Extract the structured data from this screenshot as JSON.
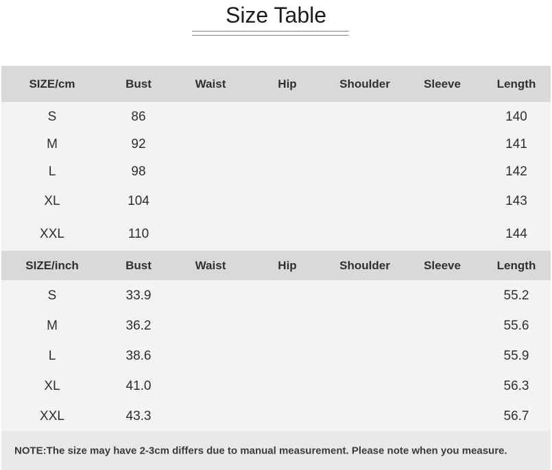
{
  "title": "Size Table",
  "tables": [
    {
      "headers": [
        "SIZE/cm",
        "Bust",
        "Waist",
        "Hip",
        "Shoulder",
        "Sleeve",
        "Length"
      ],
      "rows": [
        [
          "S",
          "86",
          "",
          "",
          "",
          "",
          "140"
        ],
        [
          "M",
          "92",
          "",
          "",
          "",
          "",
          "141"
        ],
        [
          "L",
          "98",
          "",
          "",
          "",
          "",
          "142"
        ],
        [
          "XL",
          "104",
          "",
          "",
          "",
          "",
          "143"
        ],
        [
          "XXL",
          "110",
          "",
          "",
          "",
          "",
          "144"
        ]
      ]
    },
    {
      "headers": [
        "SIZE/inch",
        "Bust",
        "Waist",
        "Hip",
        "Shoulder",
        "Sleeve",
        "Length"
      ],
      "rows": [
        [
          "S",
          "33.9",
          "",
          "",
          "",
          "",
          "55.2"
        ],
        [
          "M",
          "36.2",
          "",
          "",
          "",
          "",
          "55.6"
        ],
        [
          "L",
          "38.6",
          "",
          "",
          "",
          "",
          "55.9"
        ],
        [
          "XL",
          "41.0",
          "",
          "",
          "",
          "",
          "56.3"
        ],
        [
          "XXL",
          "43.3",
          "",
          "",
          "",
          "",
          "56.7"
        ]
      ]
    }
  ],
  "note": "NOTE:The size may have 2-3cm differs due to manual measurement. Please note when you measure.",
  "colors": {
    "header_band": "#d9d9d9",
    "body_band": "#f3f3f3",
    "note_band": "#e9e9e9"
  }
}
